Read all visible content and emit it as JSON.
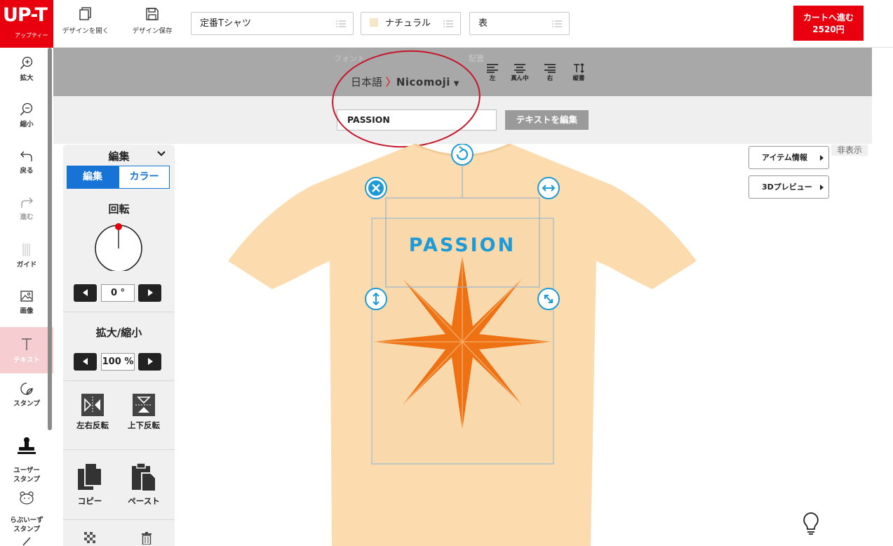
{
  "logo": {
    "text": "UP-T",
    "sub": "アップティー"
  },
  "toolbar": {
    "open_label": "デザインを開く",
    "save_label": "デザイン保存",
    "product": "定番Tシャツ",
    "color": "ナチュラル",
    "side": "表",
    "cart_label": "カートへ進む",
    "cart_price": "2520円"
  },
  "sidebar": {
    "items": [
      {
        "label": "拡大"
      },
      {
        "label": "縮小"
      },
      {
        "label": "戻る"
      },
      {
        "label": "進む"
      },
      {
        "label": "ガイド"
      },
      {
        "label": "画像"
      },
      {
        "label": "テキスト"
      },
      {
        "label": "スタンプ"
      },
      {
        "label": "ユーザー\nスタンプ"
      },
      {
        "label": "らぶいーず\nスタンプ"
      }
    ]
  },
  "font_toolbar": {
    "ghost_font": "フォント",
    "ghost_align": "配置",
    "language": "日本語",
    "font_name": "Nicomoji",
    "align": [
      "左",
      "真ん中",
      "右",
      "縦書"
    ]
  },
  "text_edit": {
    "value": "PASSION",
    "edit_button": "テキストを編集"
  },
  "panel": {
    "title": "編集",
    "tab_edit": "編集",
    "tab_color": "カラー",
    "rotate_label": "回転",
    "rotate_value": "0",
    "rotate_unit": "°",
    "scale_label": "拡大/縮小",
    "scale_value": "100",
    "scale_unit": "%",
    "flip_h": "左右反転",
    "flip_v": "上下反転",
    "copy": "コピー",
    "paste": "ペースト"
  },
  "right": {
    "item_info": "アイテム情報",
    "preview_3d": "3Dプレビュー",
    "hide": "非表示"
  },
  "design": {
    "text": "PASSION",
    "text_color": "#1e9ad6",
    "star_color": "#ee7214",
    "shirt_color": "#fcdcae"
  }
}
